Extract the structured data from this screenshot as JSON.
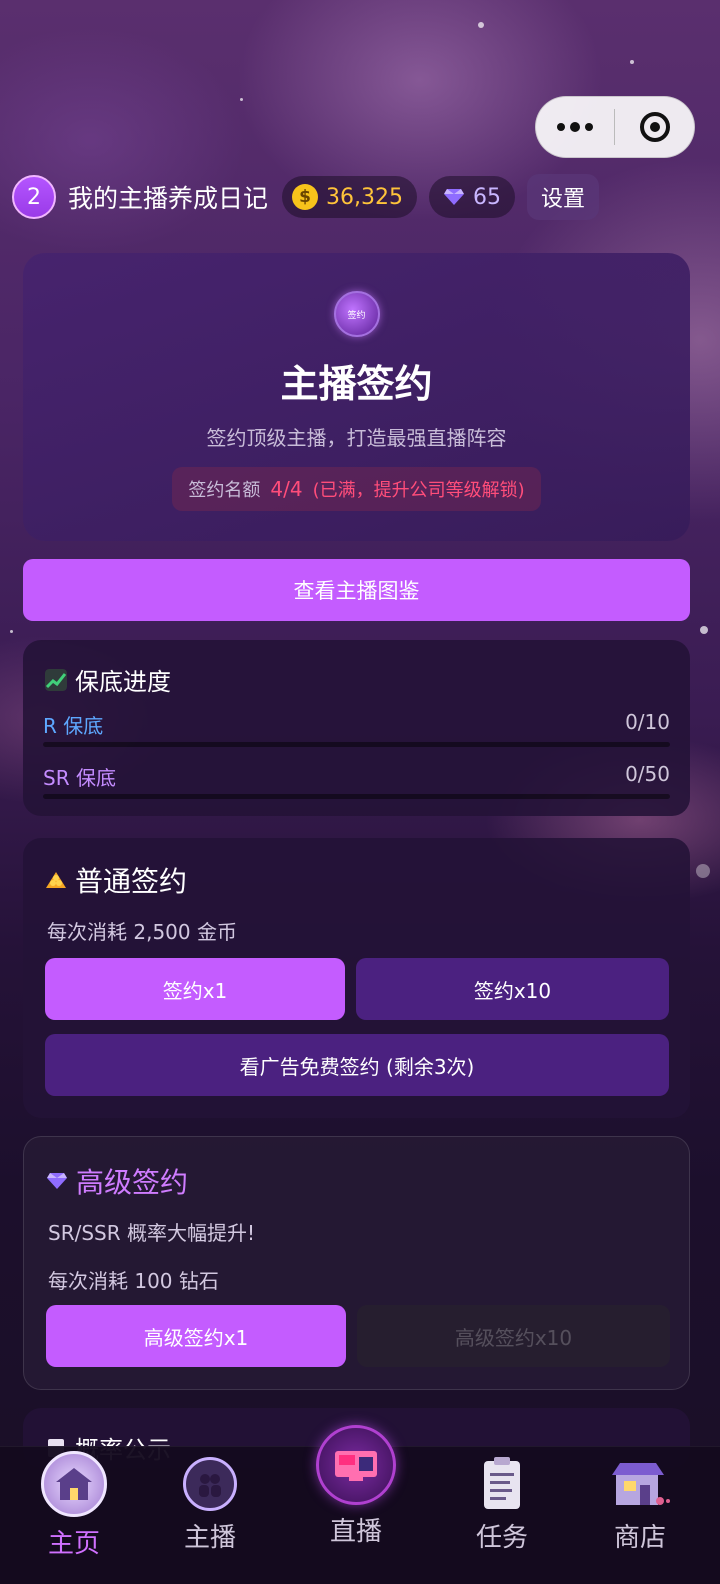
{
  "header": {
    "level": "2",
    "title": "我的主播养成日记",
    "coins": "36,325",
    "coin_symbol": "$",
    "diamonds": "65",
    "settings_label": "设置"
  },
  "hero": {
    "badge_text": "签约",
    "title": "主播签约",
    "subtitle": "签约顶级主播，打造最强直播阵容",
    "quota_label": "签约名额",
    "quota_value": "4/4",
    "quota_note": "(已满，提升公司等级解锁)"
  },
  "atlas_button": "查看主播图鉴",
  "guarantee": {
    "title": "保底进度",
    "rows": [
      {
        "label": "R 保底",
        "value": "0/10",
        "progress": 0
      },
      {
        "label": "SR 保底",
        "value": "0/50",
        "progress": 0
      }
    ]
  },
  "normal_sign": {
    "title": "普通签约",
    "cost": "每次消耗 2,500 金币",
    "btn_x1": "签约x1",
    "btn_x10": "签约x10",
    "btn_ad": "看广告免费签约 (剩余3次)"
  },
  "premium_sign": {
    "title": "高级签约",
    "desc": "SR/SSR 概率大幅提升!",
    "cost": "每次消耗 100 钻石",
    "btn_x1": "高级签约x1",
    "btn_x10": "高级签约x10"
  },
  "next_section": {
    "title": "概率公示"
  },
  "nav": [
    {
      "label": "主页",
      "icon": "home-icon",
      "active": true
    },
    {
      "label": "主播",
      "icon": "streamer-icon",
      "active": false
    },
    {
      "label": "直播",
      "icon": "live-icon",
      "active": false
    },
    {
      "label": "任务",
      "icon": "task-icon",
      "active": false
    },
    {
      "label": "商店",
      "icon": "shop-icon",
      "active": false
    }
  ],
  "colors": {
    "accent": "#c45cff",
    "secondary": "#4b2180",
    "warning": "#ff4d7a",
    "coin": "#ffc43a"
  }
}
